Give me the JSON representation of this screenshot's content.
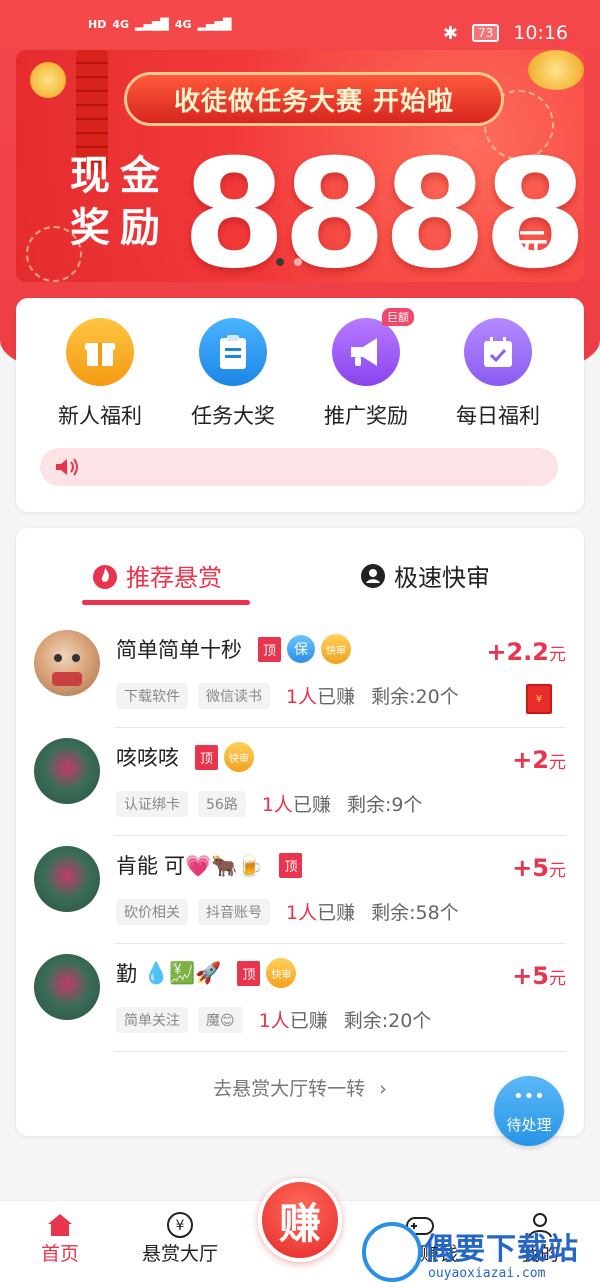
{
  "status_bar": {
    "network_labels": [
      "HD",
      "4G",
      "4G"
    ],
    "battery": "73",
    "time": "10:16"
  },
  "banner": {
    "title": "收徒做任务大赛 开始啦",
    "label_line1": "现金",
    "label_line2": "奖励",
    "amount": "8888",
    "unit": "元"
  },
  "quick_actions": [
    {
      "label": "新人福利",
      "icon": "gift-icon",
      "color": "#f6a623"
    },
    {
      "label": "任务大奖",
      "icon": "clipboard-icon",
      "color": "#2f97ee"
    },
    {
      "label": "推广奖励",
      "icon": "megaphone-icon",
      "color": "#9b5cf0",
      "badge": "巨额"
    },
    {
      "label": "每日福利",
      "icon": "calendar-check-icon",
      "color": "#9b6cf0"
    }
  ],
  "tabs": {
    "recommended": "推荐悬赏",
    "fast_review": "极速快审"
  },
  "tasks": [
    {
      "name": "简单简单十秒",
      "tag_top": "顶",
      "tag_bao": "保",
      "tag_fast": "快审",
      "chips": [
        "下载软件",
        "微信读书"
      ],
      "earned_count": "1人",
      "earned_suffix": "已赚",
      "remaining": "剩余:20个",
      "reward_amount": "+2.2",
      "reward_unit": "元"
    },
    {
      "name": "咳咳咳",
      "tag_top": "顶",
      "tag_fast": "快审",
      "chips": [
        "认证绑卡",
        "56路"
      ],
      "earned_count": "1人",
      "earned_suffix": "已赚",
      "remaining": "剩余:9个",
      "reward_amount": "+2",
      "reward_unit": "元"
    },
    {
      "name": "肯能",
      "emojis": "可💗🐂🍺",
      "tag_top": "顶",
      "chips": [
        "砍价相关",
        "抖音账号"
      ],
      "earned_count": "1人",
      "earned_suffix": "已赚",
      "remaining": "剩余:58个",
      "reward_amount": "+5",
      "reward_unit": "元"
    },
    {
      "name": "勤",
      "emojis": "💧💹🚀",
      "tag_top": "顶",
      "tag_fast": "快审",
      "chips": [
        "简单关注",
        "魔😊"
      ],
      "earned_count": "1人",
      "earned_suffix": "已赚",
      "remaining": "剩余:20个",
      "reward_amount": "+5",
      "reward_unit": "元"
    }
  ],
  "more_link": "去悬赏大厅转一转",
  "more_arrow": "›",
  "floating_button": {
    "dots": "•••",
    "label": "待处理"
  },
  "tabbar": {
    "home": "首页",
    "hall": "悬赏大厅",
    "earn": "赚",
    "games": "游戏赚钱",
    "mine": "我的",
    "active_color": "#e8344c"
  },
  "watermark": {
    "text": "偶要下载站",
    "url": "ouyaoxiazai.com"
  }
}
